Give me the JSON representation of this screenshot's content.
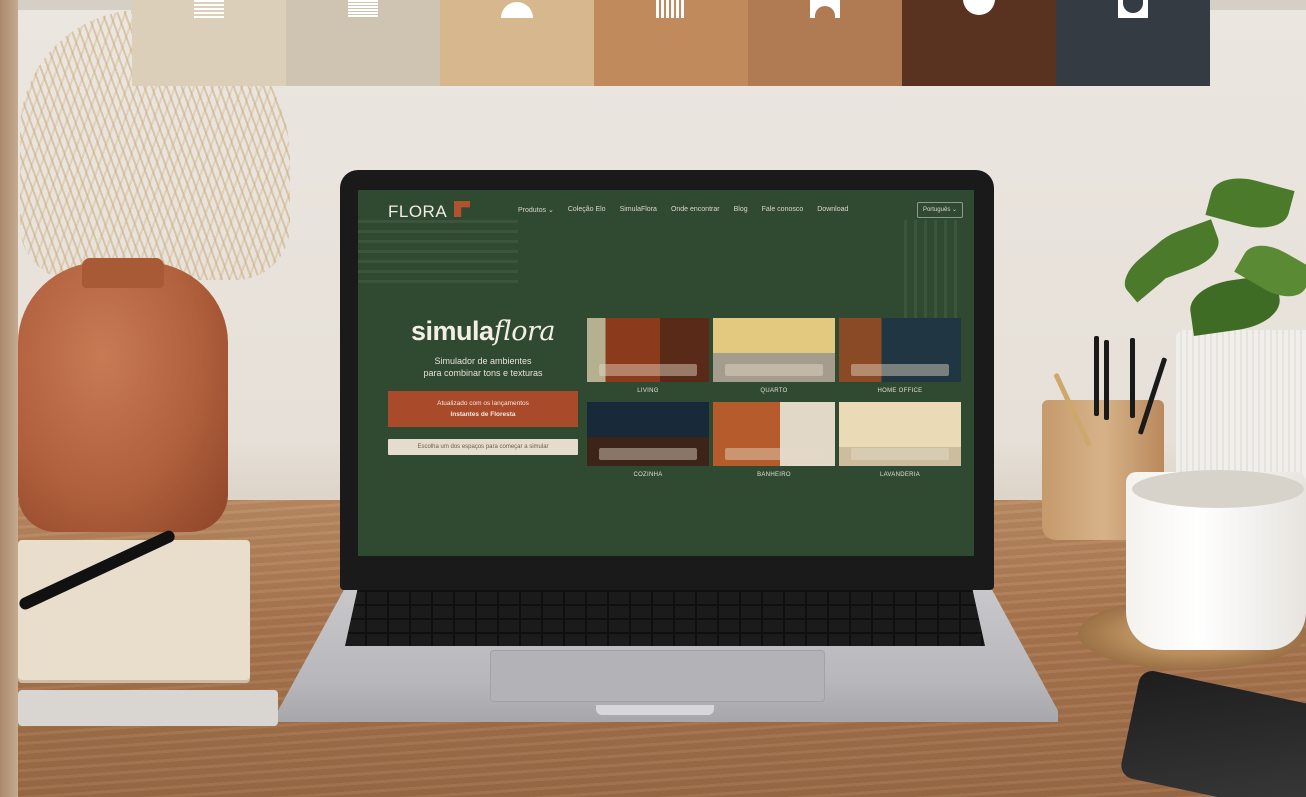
{
  "screen": {
    "brand": "FLORA",
    "nav": [
      "Produtos ⌄",
      "Coleção Elo",
      "SimulaFlora",
      "Onde encontrar",
      "Blog",
      "Fale conosco",
      "Download"
    ],
    "language": "Português ⌄",
    "hero": {
      "logo_plain": "simula",
      "logo_script": "flora",
      "subtitle_line1": "Simulador de ambientes",
      "subtitle_line2": "para combinar tons e texturas",
      "promo_line1": "Atualizado com os lançamentos",
      "promo_line2": "Instantes de Floresta",
      "cta": "Escolha um dos espaços para começar a simular"
    },
    "rooms": [
      "LIVING",
      "QUARTO",
      "HOME OFFICE",
      "COZINHA",
      "BANHEIRO",
      "LAVANDERIA"
    ]
  },
  "swatches": [
    {
      "color": "#dccfb9",
      "icon": "horizontal-lines-icon"
    },
    {
      "color": "#cfc4b2",
      "icon": "horizontal-lines-icon"
    },
    {
      "color": "#d6b78e",
      "icon": "dome-icon"
    },
    {
      "color": "#c18a5c",
      "icon": "vertical-lines-icon"
    },
    {
      "color": "#b07a52",
      "icon": "arch-icon"
    },
    {
      "color": "#5a3220",
      "icon": "circle-icon"
    },
    {
      "color": "#343b43",
      "icon": "bowl-icon"
    }
  ],
  "colors": {
    "screen_bg": "#2f4a31",
    "accent": "#a94a2b"
  }
}
